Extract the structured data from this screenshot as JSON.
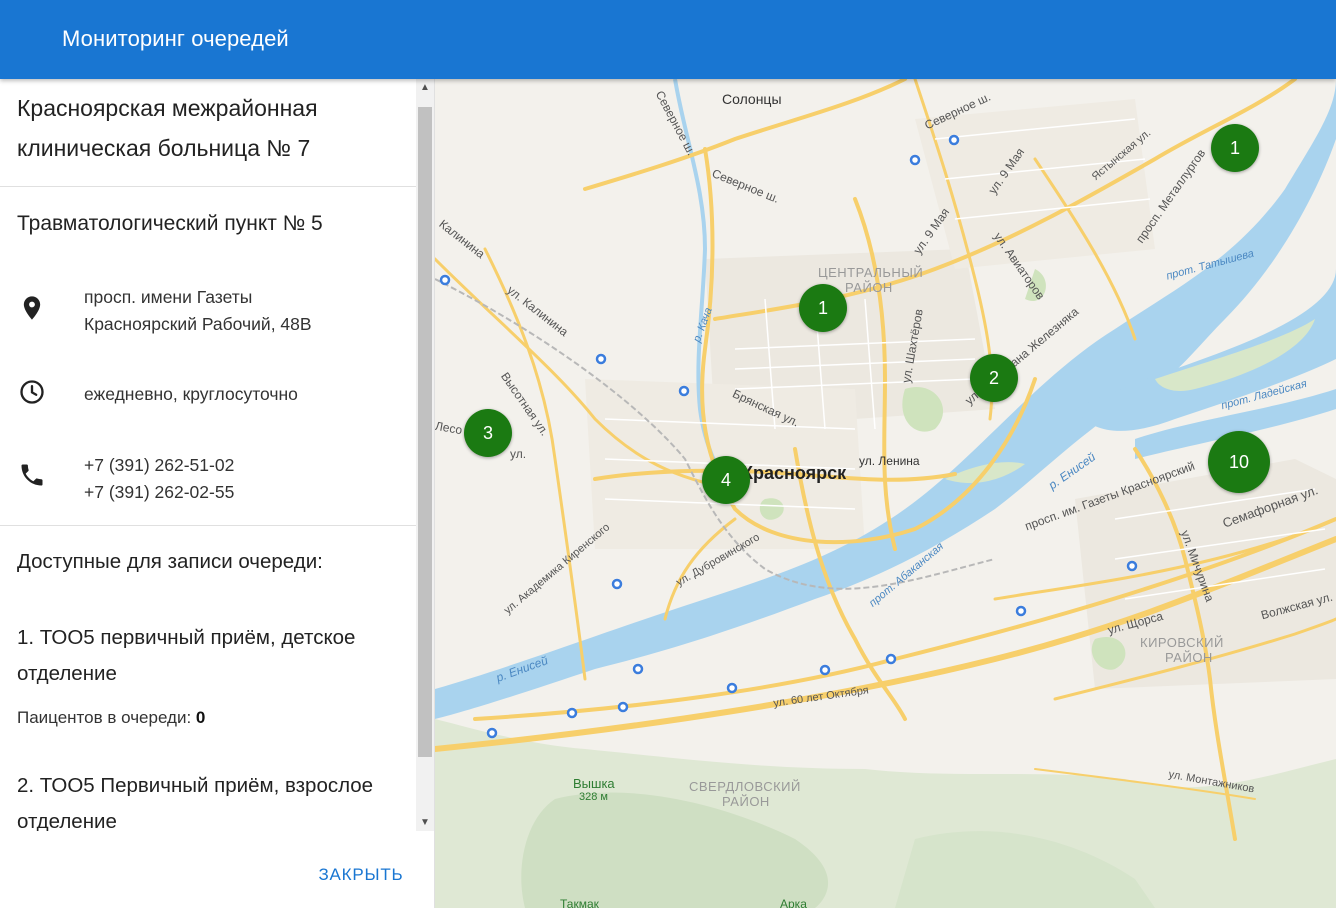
{
  "header": {
    "title": "Мониторинг очередей"
  },
  "panel": {
    "hospital_name": "Красноярская межрайонная клиническая больница № 7",
    "unit_name": "Травматологический пункт № 5",
    "address_line1": "просп. имени Газеты",
    "address_line2": "Красноярский Рабочий, 48В",
    "hours": "ежедневно, круглосуточно",
    "phone1": "+7 (391) 262-51-02",
    "phone2": "+7 (391) 262-02-55",
    "queues_title": "Доступные для записи очереди:",
    "queues": [
      {
        "name": "1. ТОО5 первичный приём, детское отделение",
        "count_label": "Паицентов в очереди:",
        "count": "0"
      },
      {
        "name": "2. ТОО5 Первичный приём, взрослое отделение"
      }
    ],
    "close_label": "ЗАКРЫТЬ",
    "icons": [
      "location-pin-icon",
      "clock-icon",
      "phone-icon",
      "chevron-up-icon",
      "chevron-down-icon"
    ]
  },
  "map": {
    "markers": [
      {
        "label": "1"
      },
      {
        "label": "1"
      },
      {
        "label": "2"
      },
      {
        "label": "3"
      },
      {
        "label": "4"
      },
      {
        "label": "10"
      }
    ],
    "labels": {
      "city": "Красноярск",
      "solontsy": "Солонцы",
      "central_district_1": "ЦЕНТРАЛЬНЫЙ",
      "central_district_2": "РАЙОН",
      "kirovsky_1": "КИРОВСКИЙ",
      "kirovsky_2": "РАЙОН",
      "sverdlovsky_1": "СВЕРДЛОВСКИЙ",
      "sverdlovsky_2": "РАЙОН",
      "vyshka": "Вышка",
      "vyshka_height": "328 м",
      "takmak": "Такмак",
      "arka": "Арка",
      "severnoe_1": "Северное ш.",
      "severnoe_2": "Северное ш.",
      "severnoe_3": "Северное ш.",
      "may9_1": "ул. 9 Мая",
      "may9_2": "ул. 9 Мая",
      "aviatorov": "ул. Авиаторов",
      "yastynskaya": "Ястынская ул.",
      "metallurgov": "просп. Металлургов",
      "kalinina": "ул. Калинина",
      "kalinina2": "Калинина",
      "vysotnaya": "Высотная ул.",
      "lesoparkovaya": "Лесо",
      "ul": "ул.",
      "kacha": "р. Кача",
      "shakhterov": "ул. Шахтёров",
      "bryanskaya": "Брянская ул.",
      "lenina": "ул. Ленина",
      "krasnoyarsky": "просп. им. Газеты Красноярский",
      "zheleznyaka": "ул. Партизана Железняка",
      "tatysheva": "прот. Татышева",
      "ladeyskaya": "прот. Ладейская",
      "yenisei_1": "р. Енисей",
      "yenisei_2": "р. Енисей",
      "abakanskaya": "прот. Абаканская",
      "semafornaya": "Семафорная ул.",
      "michurina": "ул. Мичурина",
      "volzhskaya": "Волжская ул.",
      "shchorsa": "ул. Щорса",
      "oktyabrya": "ул. 60 лет Октября",
      "montazhnikov": "ул. Монтажников",
      "dubrovinskogo": "ул. Дубровинского",
      "kirenskogo": "ул. Академика Киренского"
    }
  }
}
